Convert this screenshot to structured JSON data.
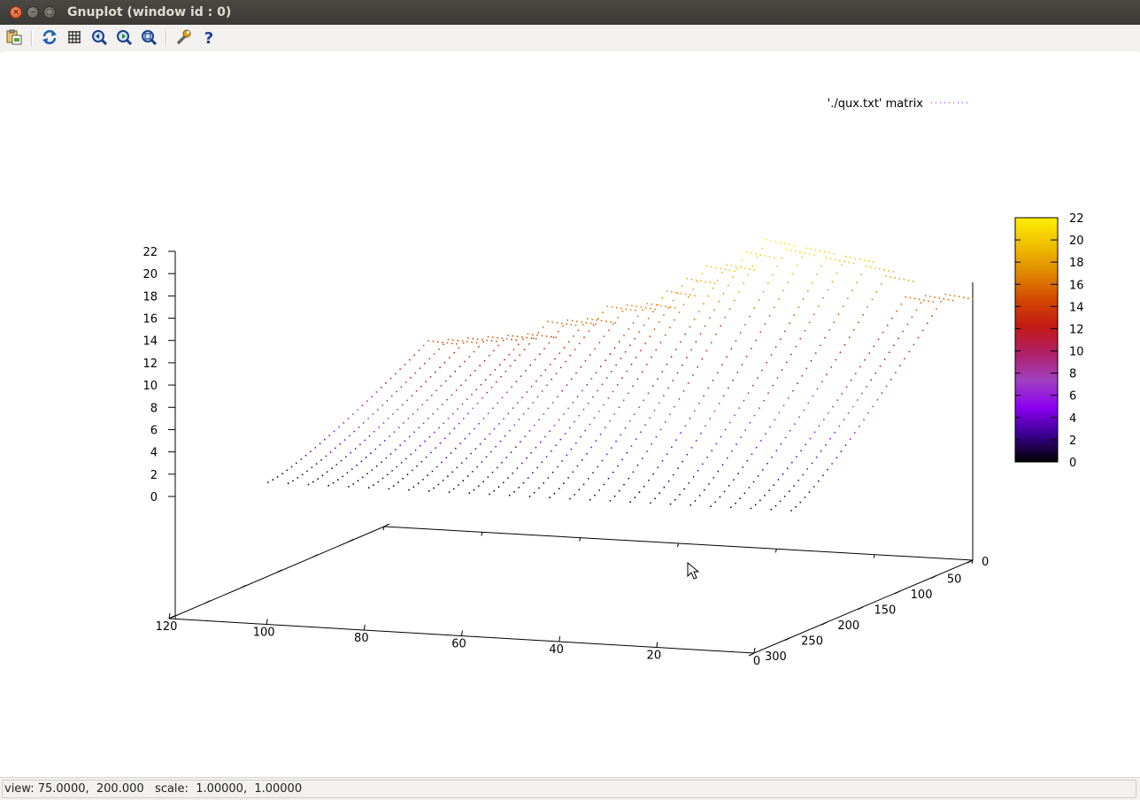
{
  "window": {
    "title": "Gnuplot (window id : 0)",
    "close_symbol": "×",
    "minimize_symbol": "–",
    "maximize_symbol": "□"
  },
  "toolbar": {
    "buttons": [
      {
        "name": "copy-to-clipboard-button",
        "icon": "clipboard-icon"
      },
      {
        "name": "replot-button",
        "icon": "refresh-icon"
      },
      {
        "name": "grid-button",
        "icon": "grid-icon"
      },
      {
        "name": "zoom-previous-button",
        "icon": "zoom-back-icon"
      },
      {
        "name": "zoom-next-button",
        "icon": "zoom-forward-icon"
      },
      {
        "name": "autoscale-button",
        "icon": "zoom-fit-icon"
      },
      {
        "name": "options-button",
        "icon": "wrench-icon"
      },
      {
        "name": "help-button",
        "icon": "question-icon"
      }
    ]
  },
  "chart_data": {
    "type": "surface-3d",
    "style": "dots",
    "legend": {
      "text": "'./qux.txt' matrix",
      "placement": "top-right"
    },
    "z_ticks": [
      "0",
      "2",
      "4",
      "6",
      "8",
      "10",
      "12",
      "14",
      "16",
      "18",
      "20",
      "22"
    ],
    "zlim": [
      0,
      22
    ],
    "x_ticks": [
      "120",
      "100",
      "80",
      "60",
      "40",
      "20",
      "0"
    ],
    "xlim": [
      0,
      120
    ],
    "y_ticks": [
      "0",
      "50",
      "100",
      "150",
      "200",
      "250",
      "300"
    ],
    "ylim": [
      0,
      300
    ],
    "colorbox": {
      "ticks": [
        "0",
        "2",
        "4",
        "6",
        "8",
        "10",
        "12",
        "14",
        "16",
        "18",
        "20",
        "22"
      ],
      "range": [
        0,
        22
      ],
      "palette": [
        "#000000",
        "#3a0090",
        "#8a00f0",
        "#a040c0",
        "#b0206a",
        "#c41a14",
        "#d24a00",
        "#e08a00",
        "#f0c000",
        "#ffee00"
      ]
    },
    "series": [
      {
        "ridge_peaks": [
          15,
          15,
          15,
          15,
          15,
          15,
          16,
          16,
          16,
          17,
          17,
          17,
          18,
          19,
          20,
          20,
          21,
          22,
          21,
          21,
          20,
          20,
          19,
          18,
          16,
          16,
          16
        ]
      }
    ]
  },
  "status": {
    "text": "view: 75.0000,  200.000   scale:  1.00000,  1.00000"
  }
}
